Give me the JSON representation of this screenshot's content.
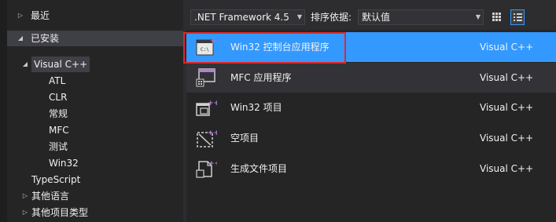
{
  "sidebar": {
    "recent": "最近",
    "installed": "已安装",
    "visual_cpp": "Visual C++",
    "children": [
      "ATL",
      "CLR",
      "常规",
      "MFC",
      "测试",
      "Win32"
    ],
    "typescript": "TypeScript",
    "other_languages": "其他语言",
    "other_project_types": "其他项目类型"
  },
  "toolbar": {
    "framework": ".NET Framework 4.5",
    "sort_label": "排序依据:",
    "sort_value": "默认值"
  },
  "templates": [
    {
      "name": "Win32 控制台应用程序",
      "lang": "Visual C++",
      "icon": "console-app-icon"
    },
    {
      "name": "MFC 应用程序",
      "lang": "Visual C++",
      "icon": "mfc-app-icon"
    },
    {
      "name": "Win32 项目",
      "lang": "Visual C++",
      "icon": "win32-project-icon"
    },
    {
      "name": "空项目",
      "lang": "Visual C++",
      "icon": "empty-project-icon"
    },
    {
      "name": "生成文件项目",
      "lang": "Visual C++",
      "icon": "makefile-project-icon"
    }
  ],
  "colors": {
    "selection": "#3399ff",
    "highlight_box": "#e02828",
    "plus_marker": "#b180d7"
  }
}
